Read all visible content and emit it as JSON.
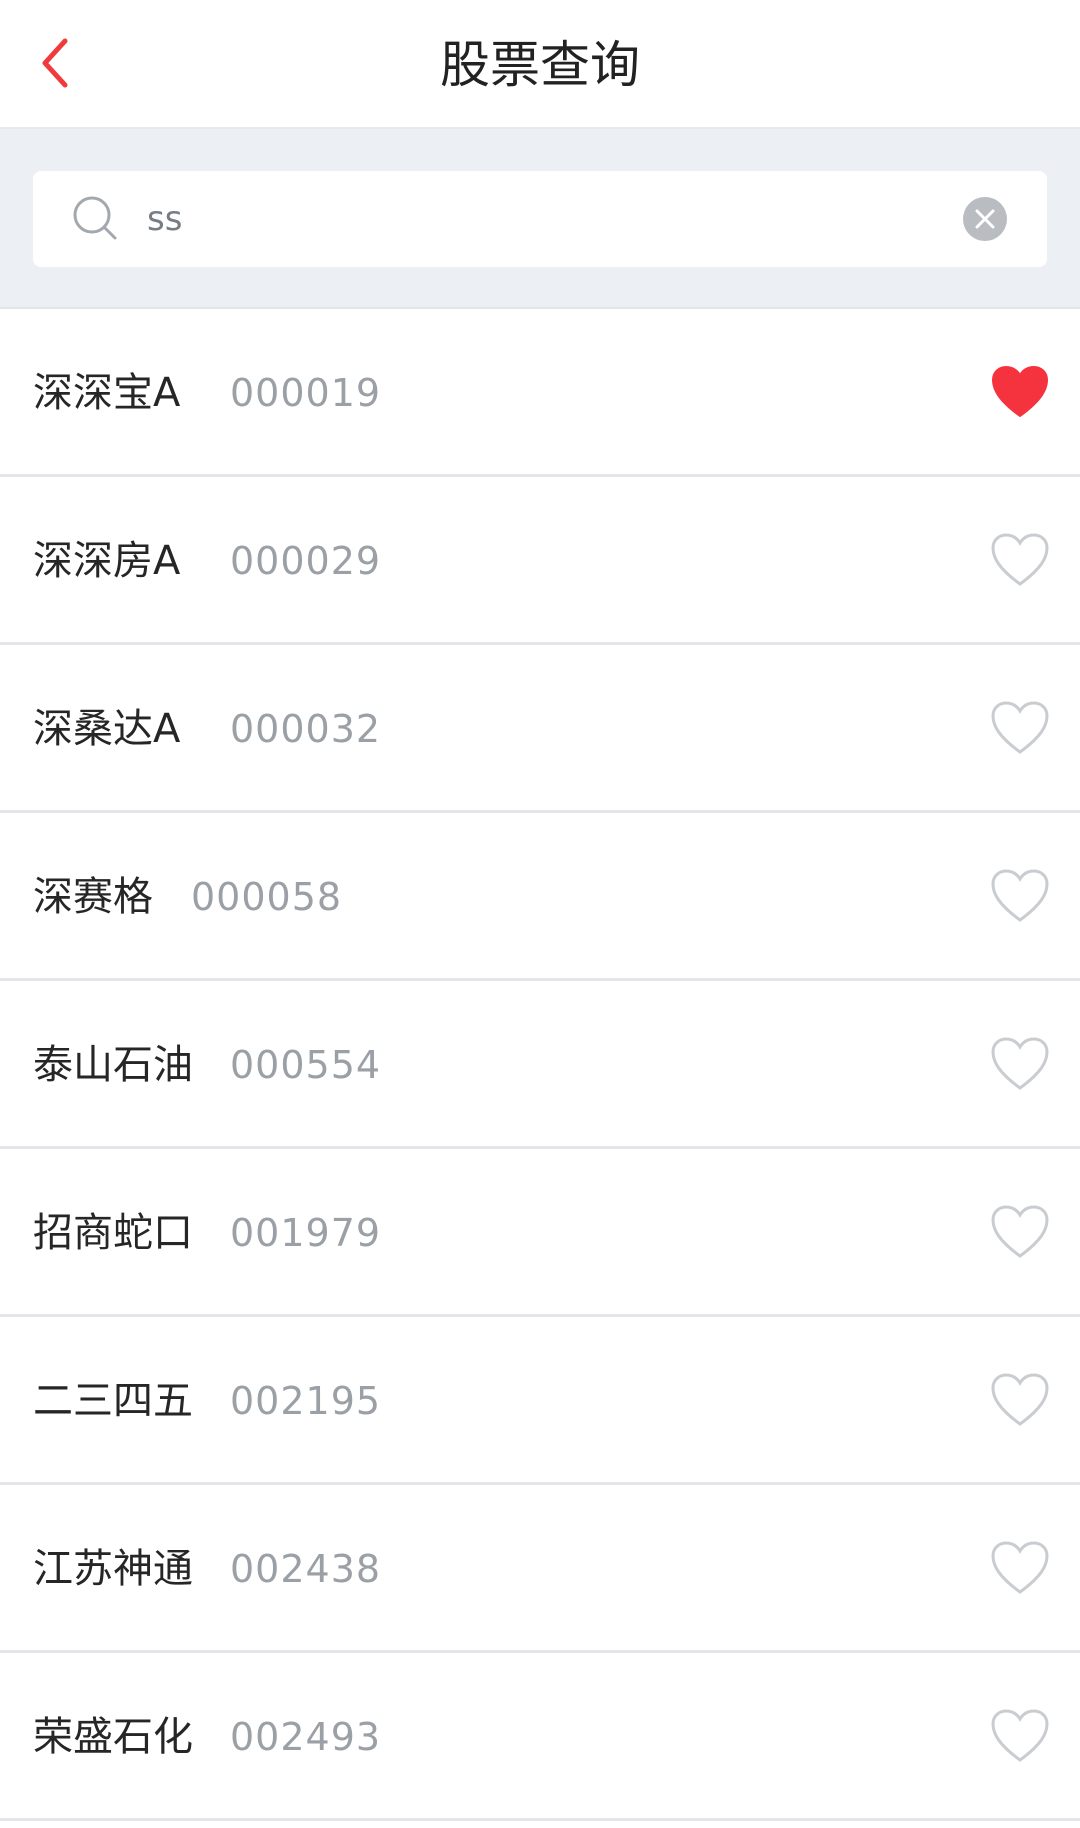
{
  "header": {
    "title": "股票查询"
  },
  "search": {
    "value": "ss"
  },
  "stocks": [
    {
      "name": "深深宝A",
      "code": "000019",
      "favorited": true
    },
    {
      "name": "深深房A",
      "code": "000029",
      "favorited": false
    },
    {
      "name": "深桑达A",
      "code": "000032",
      "favorited": false
    },
    {
      "name": "深赛格",
      "code": "000058",
      "favorited": false
    },
    {
      "name": "泰山石油",
      "code": "000554",
      "favorited": false
    },
    {
      "name": "招商蛇口",
      "code": "001979",
      "favorited": false
    },
    {
      "name": "二三四五",
      "code": "002195",
      "favorited": false
    },
    {
      "name": "江苏神通",
      "code": "002438",
      "favorited": false
    },
    {
      "name": "荣盛石化",
      "code": "002493",
      "favorited": false
    }
  ],
  "icons": {
    "back": "chevron-left-icon",
    "search": "search-icon",
    "clear": "clear-icon",
    "favorite": "heart-icon"
  },
  "colors": {
    "accent": "#f03a3c",
    "favorite": "#f5333f",
    "outline": "#c9ccd0"
  }
}
